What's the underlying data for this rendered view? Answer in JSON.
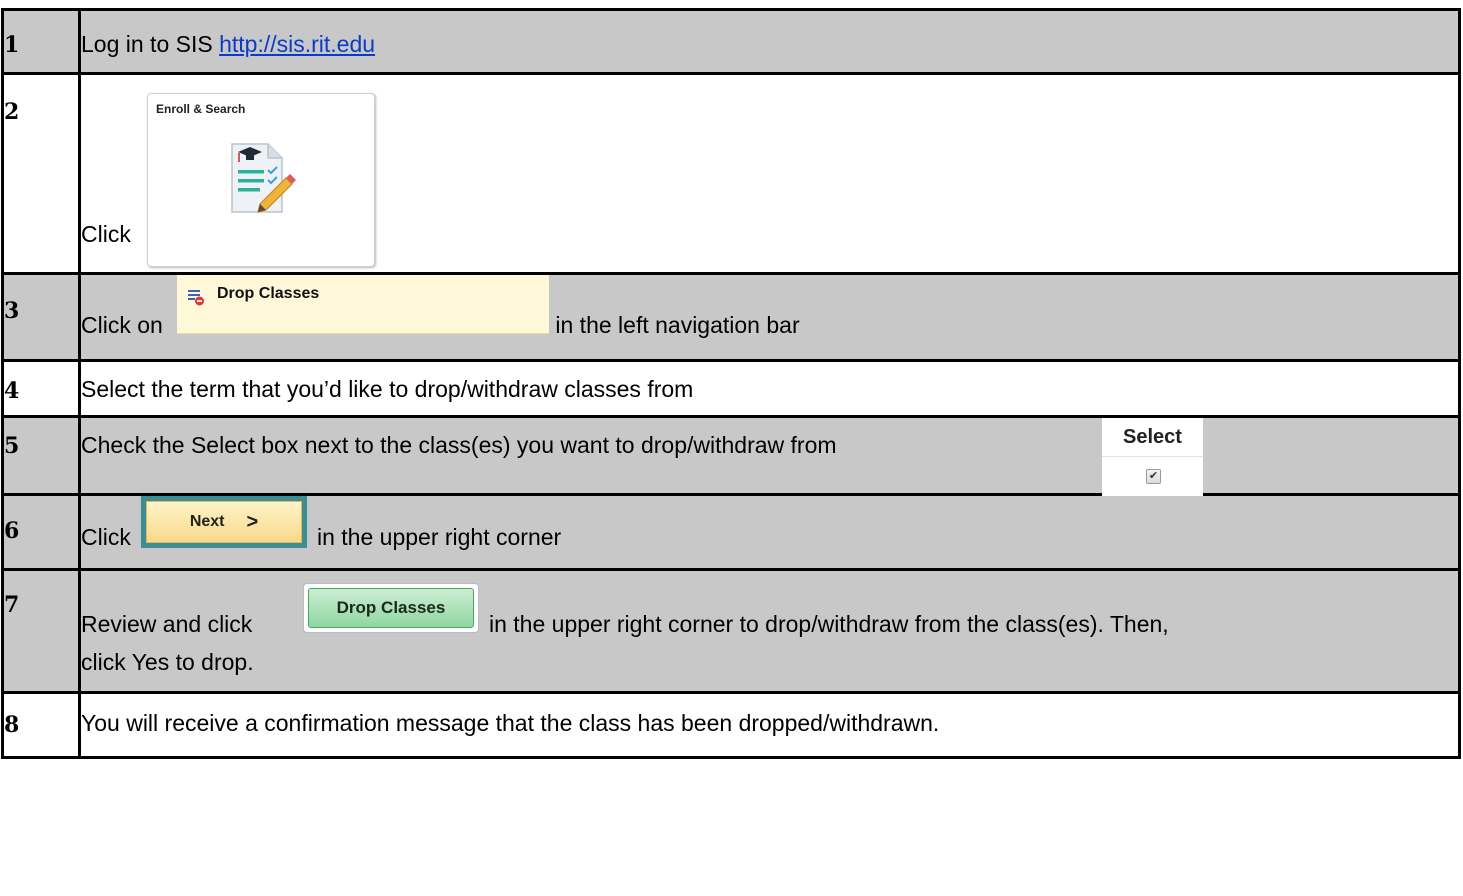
{
  "steps": [
    {
      "num": "1",
      "pre": "Log in to SIS ",
      "link": "http://sis.rit.edu"
    },
    {
      "num": "2",
      "pre": "Click",
      "tile_title": "Enroll & Search"
    },
    {
      "num": "3",
      "pre": "Click on ",
      "nav_label": "Drop Classes",
      "post": " in the left navigation bar"
    },
    {
      "num": "4",
      "text": "Select the term that you’d like to drop/withdraw classes from"
    },
    {
      "num": "5",
      "text": "Check the Select box next to the class(es) you want to drop/withdraw from",
      "select_label": "Select",
      "checkbox_mark": "✔"
    },
    {
      "num": "6",
      "pre": "Click",
      "button_label": "Next",
      "button_chevron": ">",
      "post": "in the upper right corner"
    },
    {
      "num": "7",
      "pre": "Review and click",
      "button_label": "Drop Classes",
      "post": "in the upper right corner to drop/withdraw from the class(es). Then,",
      "line2": "click Yes to drop."
    },
    {
      "num": "8",
      "text": "You will receive a confirmation message that the class has been dropped/withdrawn."
    }
  ],
  "colors": {
    "gray_row": "#c8c8c8",
    "link": "#0b3cc8",
    "nav_bg": "#fef7d8",
    "next_frame": "#3d8d94",
    "drop_green": "#8fd6a0"
  },
  "icons": {
    "tile": "enroll-search-document-icon",
    "nav": "drop-classes-icon"
  }
}
